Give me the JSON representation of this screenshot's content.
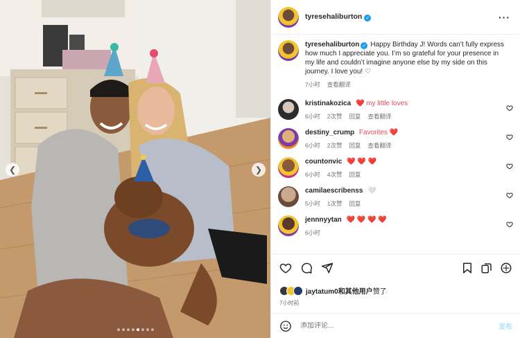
{
  "post": {
    "author": "tyresehaliburton",
    "more_icon": "more-horizontal-icon",
    "slide_count": 8,
    "active_slide": 5
  },
  "caption": {
    "username": "tyresehaliburton",
    "text": "Happy Birthday J! Words can’t fully express how much I appreciate you. I’m so grateful for your presence in my life and couldn’t imagine anyone else by my side on this journey. I love you! ♡",
    "time": "7小时",
    "translate": "查看翻译"
  },
  "comments": [
    {
      "username": "kristinakozica",
      "text": "❤️ my little loves",
      "time": "6小时",
      "likes": "2次赞",
      "reply": "回复",
      "translate": "查看翻译"
    },
    {
      "username": "destiny_crump",
      "text": "Favorites ❤️",
      "time": "6小时",
      "likes": "2次赞",
      "reply": "回复",
      "translate": "查看翻译"
    },
    {
      "username": "countonvic",
      "text": "❤️ ❤️ ❤️",
      "time": "6小时",
      "likes": "4次赞",
      "reply": "回复",
      "translate": ""
    },
    {
      "username": "camilaescribenss",
      "text": "🤍",
      "time": "5小时",
      "likes": "1次赞",
      "reply": "回复",
      "translate": ""
    },
    {
      "username": "jennnyytan",
      "text": "❤️ ❤️ ❤️ ❤️",
      "time": "6小时",
      "likes": "",
      "reply": "",
      "translate": ""
    }
  ],
  "likes": {
    "first_user": "jaytatum0",
    "suffix_bold": "和其他用户",
    "suffix": "赞了",
    "time": "7小时前"
  },
  "composer": {
    "placeholder": "添加评论...",
    "post_label": "发布"
  },
  "colors": {
    "verified": "#1d9bf0",
    "heart": "#ed4956",
    "post_disabled": "#b2dffc"
  }
}
